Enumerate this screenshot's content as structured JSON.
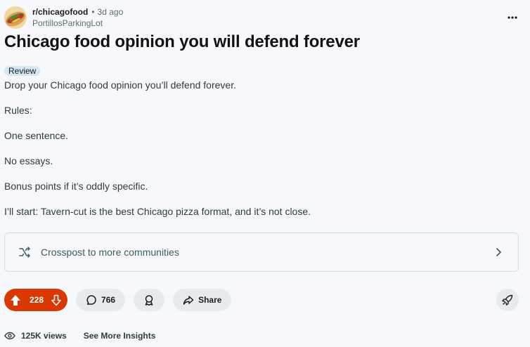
{
  "post": {
    "subreddit": "r/chicagofood",
    "separator": "•",
    "time_ago": "3d ago",
    "username": "PortillosParkingLot",
    "title": "Chicago food opinion you will defend forever",
    "flair": "Review",
    "body": [
      "Drop your Chicago food opinion you’ll defend forever.",
      "Rules:",
      "One sentence.",
      "No essays.",
      "Bonus points if it’s oddly specific.",
      "I’ll start: Tavern-cut is the best Chicago pizza format, and it’s not close."
    ]
  },
  "crosspost": {
    "label": "Crosspost to more communities"
  },
  "actions": {
    "upvotes": "228",
    "comments": "766",
    "share_label": "Share"
  },
  "insights": {
    "views": "125K views",
    "more_label": "See More Insights"
  },
  "colors": {
    "vote_bg": "#d93900",
    "pill_bg": "#e5ebee",
    "flair_bg": "#d4e7f7",
    "page_bg": "#f6f8fb"
  },
  "icons": [
    "hotdog-avatar",
    "more-icon",
    "crosspost-icon",
    "chevron-right-icon",
    "upvote-icon",
    "downvote-icon",
    "comment-icon",
    "award-icon",
    "share-icon",
    "boost-icon",
    "eye-icon"
  ]
}
